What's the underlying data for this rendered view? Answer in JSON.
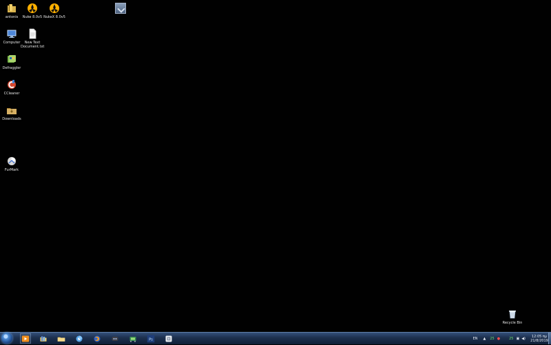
{
  "desktop": {
    "icons": [
      {
        "label": "antonis",
        "icon": "user-folder-icon"
      },
      {
        "label": "Nuke 8.0v5",
        "icon": "nuke-icon"
      },
      {
        "label": "NukeX 8.0v5",
        "icon": "nukex-icon"
      },
      {
        "label": "Computer",
        "icon": "computer-icon"
      },
      {
        "label": "New Text\nDocument.txt",
        "icon": "text-document-icon"
      },
      {
        "label": "Defraggler",
        "icon": "defraggler-icon"
      },
      {
        "label": "CCleaner",
        "icon": "ccleaner-icon"
      },
      {
        "label": "Downloads",
        "icon": "downloads-folder-icon"
      },
      {
        "label": "FurMark",
        "icon": "furmark-icon"
      },
      {
        "label": "Recycle Bin",
        "icon": "recycle-bin-icon"
      }
    ],
    "widget_icon": "gadget-icon"
  },
  "taskbar": {
    "apps": [
      {
        "name": "media-player",
        "icon": "media-player-icon",
        "active": true
      },
      {
        "name": "explorer-libraries",
        "icon": "explorer-libraries-icon",
        "active": false
      },
      {
        "name": "folder",
        "icon": "folder-icon",
        "active": false
      },
      {
        "name": "chrome-like-browser",
        "icon": "browser-icon",
        "active": false
      },
      {
        "name": "firefox",
        "icon": "firefox-icon",
        "active": false
      },
      {
        "name": "game-console",
        "icon": "game-icon",
        "active": false
      },
      {
        "name": "gpu-tool",
        "icon": "gpu-tool-icon",
        "active": false
      },
      {
        "name": "photoshop",
        "icon": "photoshop-icon",
        "active": false
      },
      {
        "name": "utility",
        "icon": "utility-icon",
        "active": false
      }
    ],
    "tray": {
      "language": "EN",
      "left_meter": "25",
      "right_meter": "25",
      "time": "12:05 πμ",
      "date": "21/8/2019"
    }
  },
  "colors": {
    "desktop_bg": "#010101",
    "taskbar_top": "#34507a",
    "taskbar_bottom": "#102039"
  }
}
